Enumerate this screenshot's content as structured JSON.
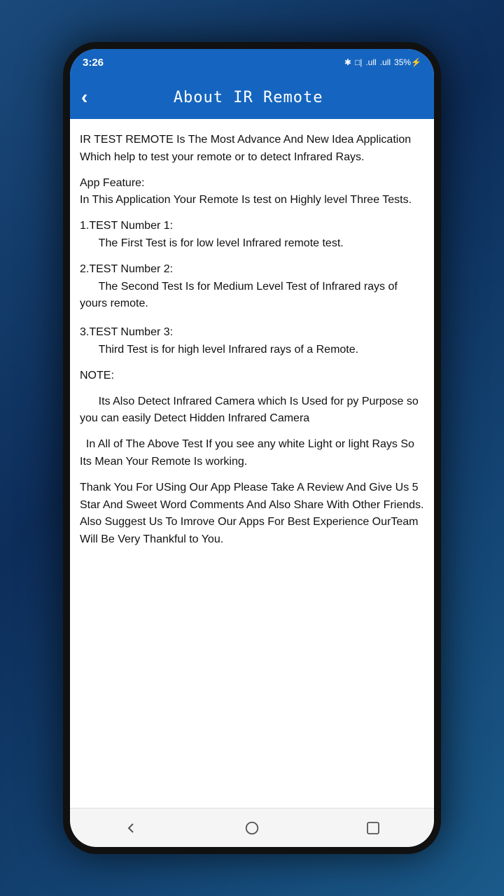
{
  "status_bar": {
    "time": "3:26",
    "icons": "✱ □| .ull .ull 35% ⚡"
  },
  "app_bar": {
    "back_label": "‹",
    "title": "About IR Remote"
  },
  "content": {
    "paragraph1": "IR TEST REMOTE Is The Most Advance And New Idea Application Which help to test your remote or to detect Infrared Rays.",
    "feature_heading": "App Feature:",
    "feature_body": "In This Application Your Remote Is test on Highly level Three Tests.",
    "test1_heading": "1.TEST Number 1:",
    "test1_body": "The First Test is for low level Infrared remote test.",
    "test2_heading": "2.TEST Number 2:",
    "test2_body": "The Second Test Is for Medium Level Test of Infrared rays of yours remote.",
    "test3_heading": "3.TEST Number 3:",
    "test3_body": "Third Test is for high level Infrared rays of a Remote.",
    "note_heading": "NOTE:",
    "note_body": "Its Also Detect Infrared Camera which Is Used for py Purpose so you can easily Detect Hidden Infrared Camera",
    "light_note": "In All of The Above Test If you see any white Light or light Rays So Its Mean Your Remote Is working.",
    "thank_you": "Thank You For USing Our App Please Take A Review And Give Us 5 Star And Sweet Word Comments And Also Share With Other Friends.\nAlso Suggest Us To Imrove Our Apps For Best Experience OurTeam Will Be Very Thankful to You."
  },
  "bottom_nav": {
    "back_label": "back",
    "home_label": "home",
    "recent_label": "recent"
  }
}
